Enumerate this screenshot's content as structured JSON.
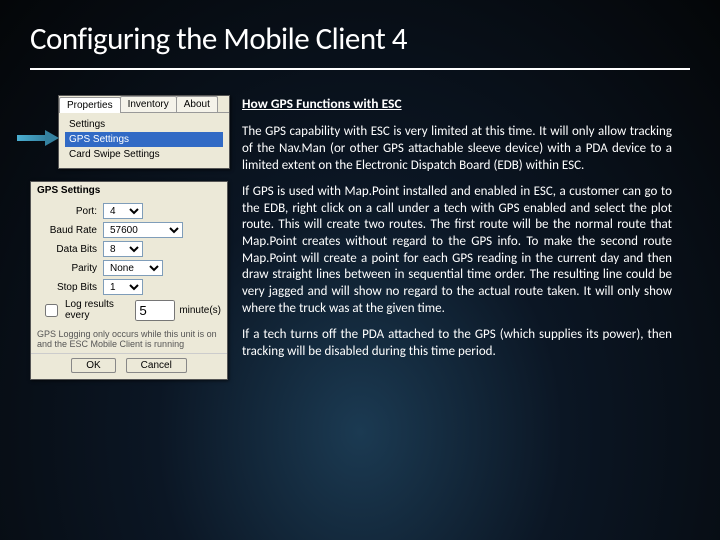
{
  "title": "Configuring the Mobile Client 4",
  "section_heading": "How GPS Functions with ESC",
  "paragraphs": {
    "p1": "The GPS capability with ESC is very limited at this time. It will only allow tracking of the Nav.Man (or other GPS attachable sleeve device) with a PDA device to a limited extent on the Electronic Dispatch Board (EDB) within ESC.",
    "p2": "If GPS is used with Map.Point installed and enabled in ESC, a customer can go to the EDB, right click on a call under a tech with GPS enabled and select the plot route. This will create two routes. The first route will be the normal route that Map.Point creates without regard to the GPS info.  To make the second route Map.Point will create a point for each GPS reading in the current day and then draw straight lines between in sequential time order. The resulting line could be very jagged and will show no regard to the actual route taken.  It will only show where the truck was at the given time.",
    "p3": "If a tech turns off the PDA attached to the GPS (which supplies its power), then tracking will be disabled during this time period."
  },
  "panel1": {
    "tabs": [
      "Properties",
      "Inventory",
      "About"
    ],
    "items": [
      "Settings",
      "GPS Settings",
      "Card Swipe Settings"
    ]
  },
  "panel2": {
    "title": "GPS Settings",
    "fields": {
      "port_label": "Port:",
      "port_value": "4",
      "baud_label": "Baud Rate",
      "baud_value": "57600",
      "data_label": "Data Bits",
      "data_value": "8",
      "parity_label": "Parity",
      "parity_value": "None",
      "stop_label": "Stop Bits",
      "stop_value": "1"
    },
    "log_label": "Log results every",
    "log_value": "5",
    "log_unit": "minute(s)",
    "note": "GPS Logging only occurs while this unit is on and the ESC Mobile Client is running",
    "ok": "OK",
    "cancel": "Cancel"
  }
}
